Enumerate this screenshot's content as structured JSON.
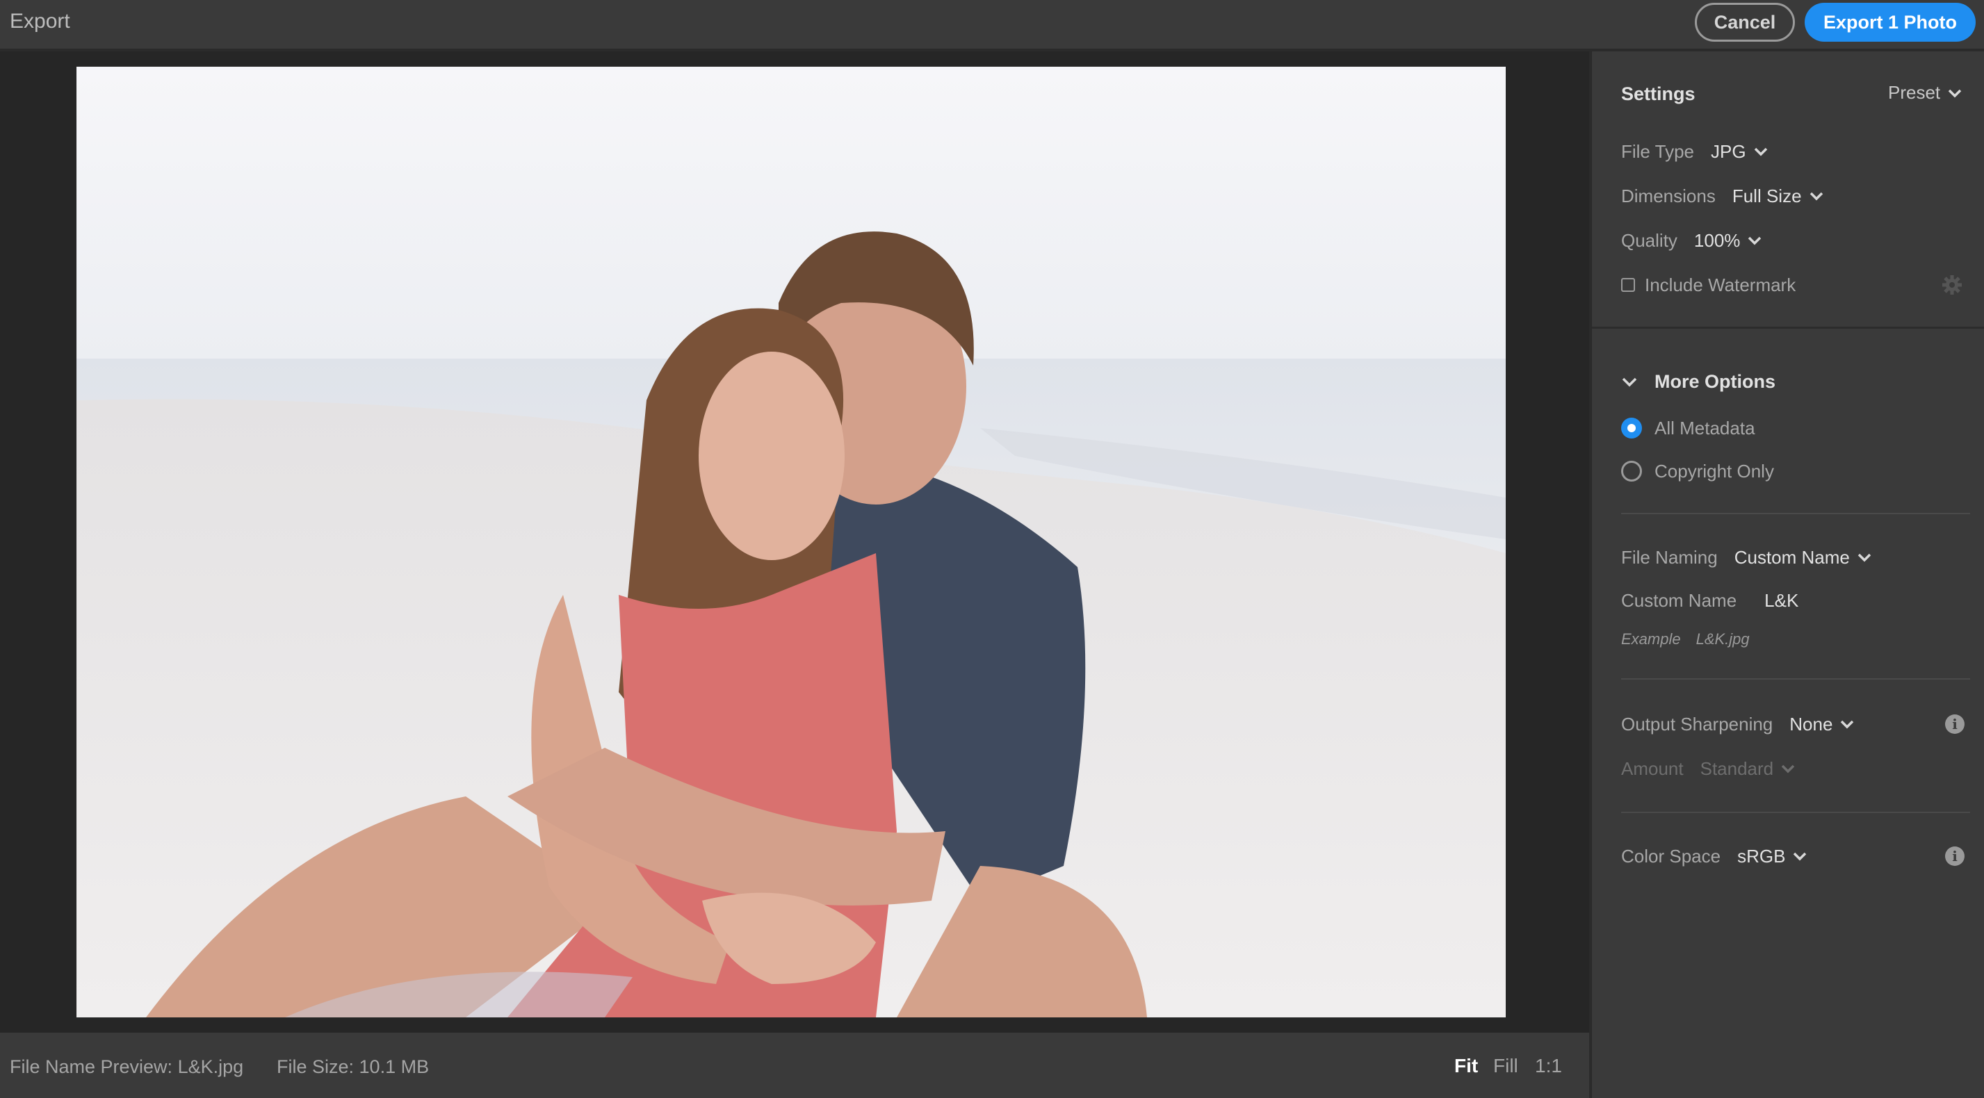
{
  "header": {
    "title": "Export",
    "cancel_label": "Cancel",
    "export_label": "Export 1 Photo",
    "accent_color": "#1f8ef1"
  },
  "footer": {
    "file_name_preview": "File Name Preview: L&K.jpg",
    "file_size": "File Size: 10.1 MB",
    "zoom": {
      "fit": "Fit",
      "fill": "Fill",
      "one_to_one": "1:1",
      "active": "Fit"
    }
  },
  "settings": {
    "title": "Settings",
    "preset_label": "Preset",
    "file_type": {
      "label": "File Type",
      "value": "JPG"
    },
    "dimensions": {
      "label": "Dimensions",
      "value": "Full Size"
    },
    "quality": {
      "label": "Quality",
      "value": "100%"
    },
    "watermark": {
      "label": "Include Watermark",
      "checked": false,
      "icon": "gear-icon"
    }
  },
  "more_options": {
    "title": "More Options",
    "metadata": {
      "all": "All Metadata",
      "copyright": "Copyright Only",
      "selected": "All Metadata"
    },
    "file_naming": {
      "label": "File Naming",
      "value": "Custom Name"
    },
    "custom_name": {
      "label": "Custom Name",
      "value": "L&K"
    },
    "example": {
      "label": "Example",
      "value": "L&K.jpg"
    },
    "output_sharpening": {
      "label": "Output Sharpening",
      "value": "None",
      "icon": "info-icon"
    },
    "amount": {
      "label": "Amount",
      "value": "Standard"
    },
    "color_space": {
      "label": "Color Space",
      "value": "sRGB",
      "icon": "info-icon"
    }
  }
}
